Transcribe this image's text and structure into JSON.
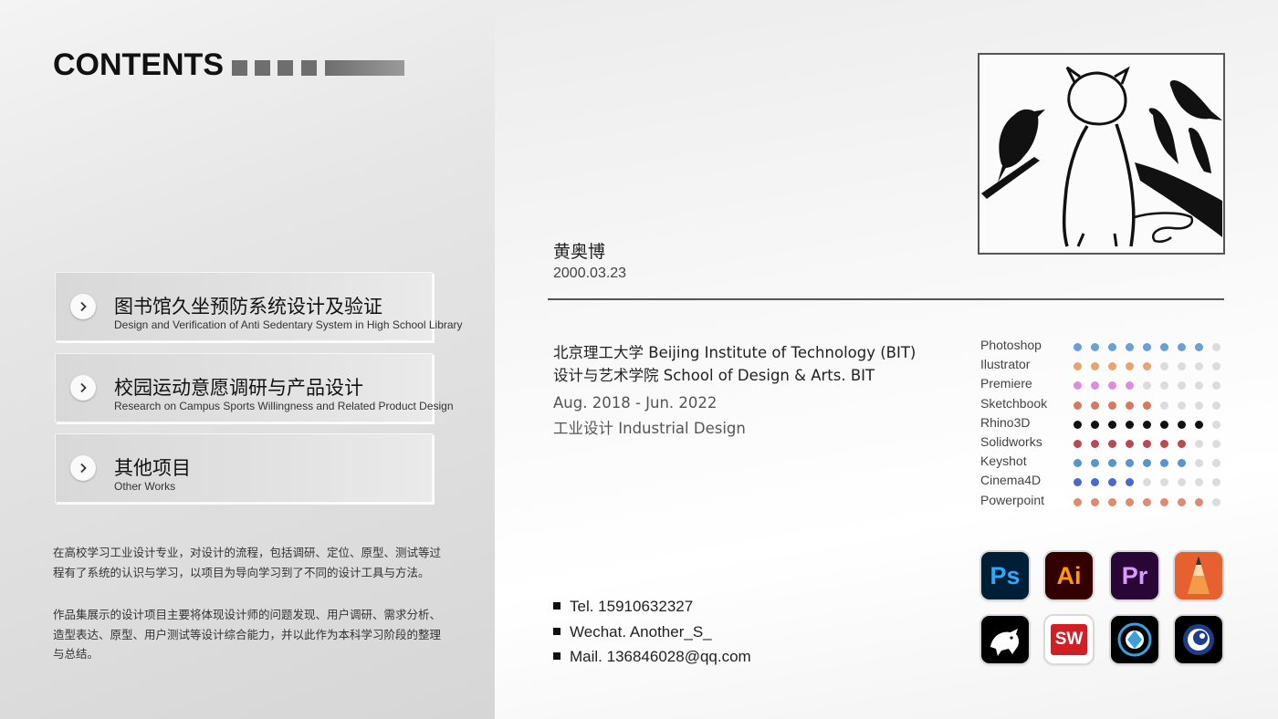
{
  "contents": {
    "title": "CONTENTS",
    "items": [
      {
        "cn": "图书馆久坐预防系统设计及验证",
        "en": "Design and Verification of Anti Sedentary System in High School Library"
      },
      {
        "cn": "校园运动意愿调研与产品设计",
        "en": "Research on Campus Sports Willingness and Related Product Design"
      },
      {
        "cn": "其他项目",
        "en": "Other Works"
      }
    ],
    "paragraph1": "在高校学习工业设计专业，对设计的流程，包括调研、定位、原型、测试等过程有了系统的认识与学习，以项目为导向学习到了不同的设计工具与方法。",
    "paragraph2": "作品集展示的设计项目主要将体现设计师的问题发现、用户调研、需求分析、造型表达、原型、用户测试等设计综合能力，并以此作为本科学习阶段的整理与总结。"
  },
  "profile": {
    "name": "黄奥博",
    "dob": "2000.03.23",
    "university": "北京理工大学  Beijing Institute of Technology (BIT)",
    "school": "设计与艺术学院 School of Design & Arts. BIT",
    "period": "Aug. 2018 - Jun. 2022",
    "major": "工业设计 Industrial Design"
  },
  "skills": [
    {
      "name": "Photoshop",
      "level": 8,
      "color": "#6a9fd8"
    },
    {
      "name": "Ilustrator",
      "level": 5,
      "color": "#e8a46a"
    },
    {
      "name": "Premiere",
      "level": 4,
      "color": "#d98ee0"
    },
    {
      "name": "Sketchbook",
      "level": 5,
      "color": "#d9785e"
    },
    {
      "name": "Rhino3D",
      "level": 8,
      "color": "#111111"
    },
    {
      "name": "Solidworks",
      "level": 7,
      "color": "#b84a52"
    },
    {
      "name": "Keyshot",
      "level": 7,
      "color": "#5a95c8"
    },
    {
      "name": "Cinema4D",
      "level": 4,
      "color": "#4a6acb"
    },
    {
      "name": "Powerpoint",
      "level": 8,
      "color": "#e08a70"
    }
  ],
  "skill_scale": 9,
  "contact": {
    "tel": "Tel. 15910632327",
    "wechat": "Wechat. Another_S_",
    "mail": "Mail. 136846028@qq.com"
  },
  "apps": {
    "ps": "Ps",
    "ai": "Ai",
    "pr": "Pr",
    "sw": "SW"
  },
  "icons": [
    "photoshop-icon",
    "illustrator-icon",
    "premiere-icon",
    "sketchbook-icon",
    "rhino-icon",
    "solidworks-icon",
    "keyshot-icon",
    "cinema4d-icon"
  ]
}
